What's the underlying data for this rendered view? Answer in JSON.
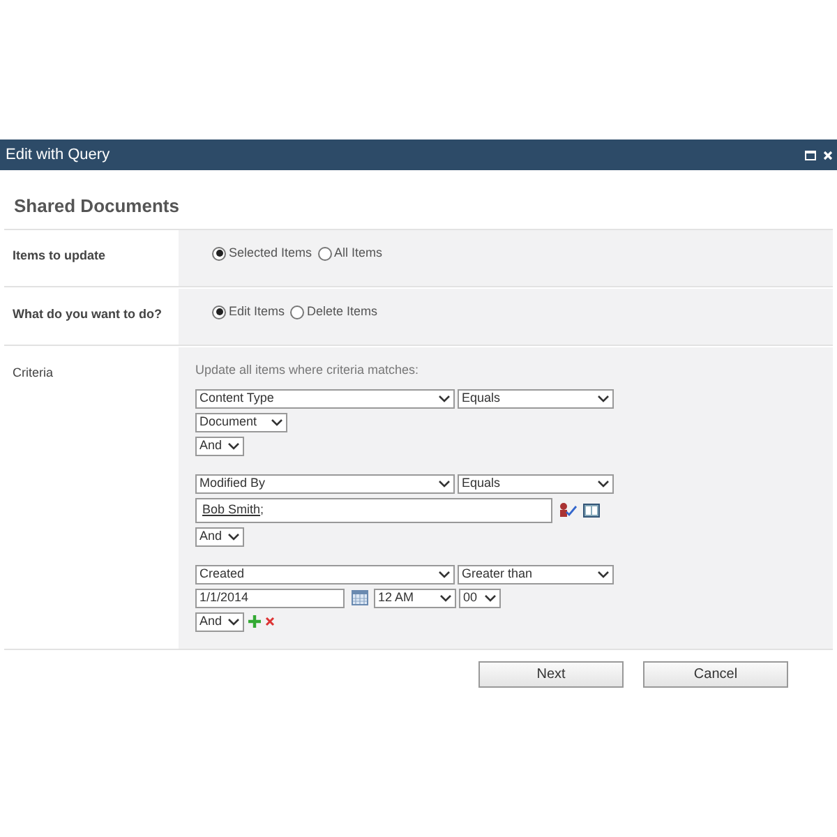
{
  "window": {
    "title": "Edit with Query"
  },
  "heading": "Shared Documents",
  "sections": [
    {
      "label": "Items to update",
      "options": [
        {
          "label": "Selected Items",
          "selected": true
        },
        {
          "label": "All Items",
          "selected": false
        }
      ]
    },
    {
      "label": "What do you want to do?",
      "options": [
        {
          "label": "Edit Items",
          "selected": true
        },
        {
          "label": "Delete Items",
          "selected": false
        }
      ]
    }
  ],
  "criteria": {
    "label": "Criteria",
    "intro": "Update all items where criteria matches:",
    "conditions": [
      {
        "field": "Content Type",
        "operator": "Equals",
        "value": {
          "kind": "select",
          "text": "Document"
        },
        "conjunction": "And",
        "row_actions": false
      },
      {
        "field": "Modified By",
        "operator": "Equals",
        "value": {
          "kind": "people",
          "name": "Bob Smith",
          "separator": ";"
        },
        "conjunction": "And",
        "row_actions": false
      },
      {
        "field": "Created",
        "operator": "Greater than",
        "value": {
          "kind": "date",
          "date": "1/1/2014",
          "hour": "12 AM",
          "minute": "00"
        },
        "conjunction": "And",
        "row_actions": true
      }
    ]
  },
  "buttons": [
    "Next",
    "Cancel"
  ]
}
